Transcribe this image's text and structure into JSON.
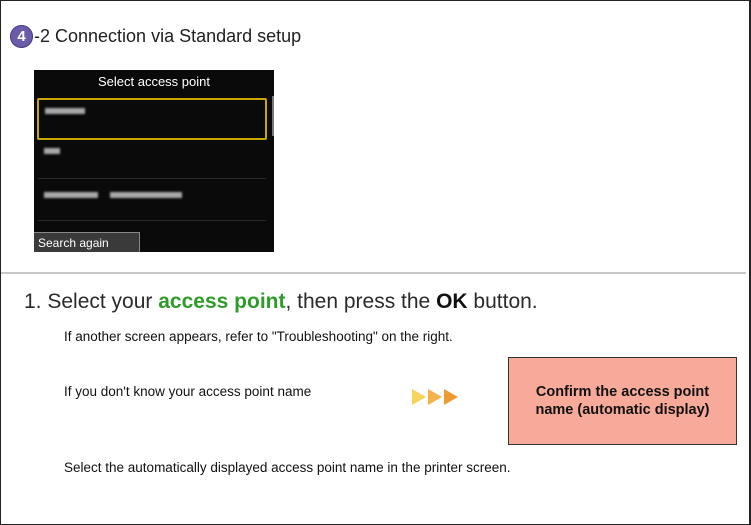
{
  "header": {
    "step_number": "4",
    "title": "-2 Connection via Standard setup"
  },
  "printer_screen": {
    "title": "Select access point",
    "search_again_label": "Search again"
  },
  "instruction": {
    "prefix": "Select your ",
    "highlight": "access point",
    "middle": ", then press the ",
    "ok": "OK",
    "suffix": " button.",
    "number": "1."
  },
  "notes": {
    "troubleshooting": "If another screen appears, refer to \"Troubleshooting\" on the right.",
    "unknown_name": "If you don't know your access point name",
    "select_auto": "Select the automatically displayed access point name in the printer screen."
  },
  "confirm_button": {
    "label": "Confirm the access point name (automatic display)"
  },
  "colors": {
    "badge": "#6b5ba8",
    "highlight": "#2e9b2a",
    "button_bg": "#f7a99a",
    "arrow_light": "#f6d35a",
    "arrow_mid": "#f4b24a",
    "arrow_dark": "#ee9a33"
  }
}
